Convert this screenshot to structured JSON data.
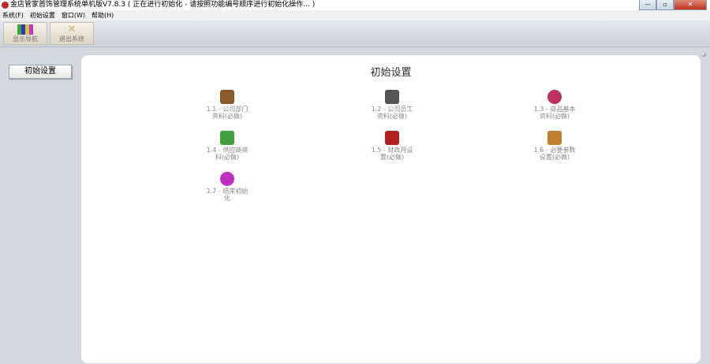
{
  "window": {
    "title": "金店管家首饰管理系统单机版V7.8.3 ( 正在进行初始化 - 请按照功能编号顺序进行初始化操作... )",
    "min": "—",
    "max": "▫",
    "close": "✕"
  },
  "menu": [
    "系统(F)",
    "初始设置",
    "窗口(W)",
    "帮助(H)"
  ],
  "toolbar": {
    "show_nav": "显示导航",
    "exit": "退出系统"
  },
  "nav": {
    "initial_settings": "初始设置"
  },
  "main": {
    "title": "初始设置",
    "items": [
      {
        "label": "1.1 - 公司部门资料(必做)",
        "icon": "house-icon",
        "color": "#8b5a2b"
      },
      {
        "label": "1.2 - 公司员工资料(必做)",
        "icon": "employee-icon",
        "color": "#555555"
      },
      {
        "label": "1.3 - 商品基本资料(必做)",
        "icon": "rings-icon",
        "color": "#c03060"
      },
      {
        "label": "1.4 - 供应商资料(必做)",
        "icon": "supplier-grid-icon",
        "color": "#40a040"
      },
      {
        "label": "1.5 - 财政月设置(必做)",
        "icon": "calendar-icon",
        "color": "#b02020"
      },
      {
        "label": "1.6 - 必要参数设置(必做)",
        "icon": "parameter-icon",
        "color": "#c08030"
      },
      {
        "label": "1.7 - 结束初始化",
        "icon": "refresh-icon",
        "color": "#c030c0"
      }
    ]
  }
}
